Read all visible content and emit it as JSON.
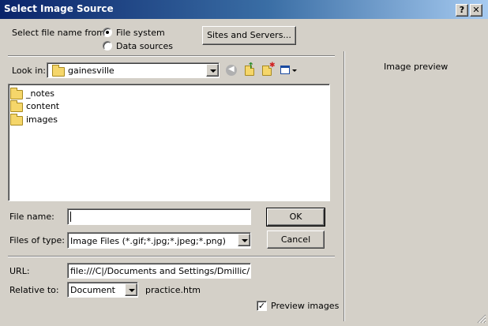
{
  "window": {
    "title": "Select Image Source",
    "help_button": "?",
    "close_button": "X"
  },
  "source": {
    "label": "Select file name from:",
    "options": [
      "File system",
      "Data sources"
    ],
    "selected": "File system",
    "sites_button": "Sites and Servers..."
  },
  "look_in": {
    "label": "Look in:",
    "value": "gainesville"
  },
  "toolbar_icons": [
    "back-icon",
    "up-folder-icon",
    "new-folder-icon",
    "view-menu-icon"
  ],
  "files": [
    {
      "name": "_notes",
      "icon": "folder-icon"
    },
    {
      "name": "content",
      "icon": "folder-icon"
    },
    {
      "name": "images",
      "icon": "folder-icon"
    }
  ],
  "file_name": {
    "label": "File name:",
    "value": ""
  },
  "file_type": {
    "label": "Files of type:",
    "value": "Image Files (*.gif;*.jpg;*.jpeg;*.png)"
  },
  "buttons": {
    "ok": "OK",
    "cancel": "Cancel"
  },
  "url": {
    "label": "URL:",
    "value": "file:///C|/Documents and Settings/Dmillic/Desk"
  },
  "relative_to": {
    "label": "Relative to:",
    "value": "Document",
    "file": "practice.htm"
  },
  "preview": {
    "title": "Image preview",
    "checkbox_label": "Preview images",
    "checked": true
  }
}
